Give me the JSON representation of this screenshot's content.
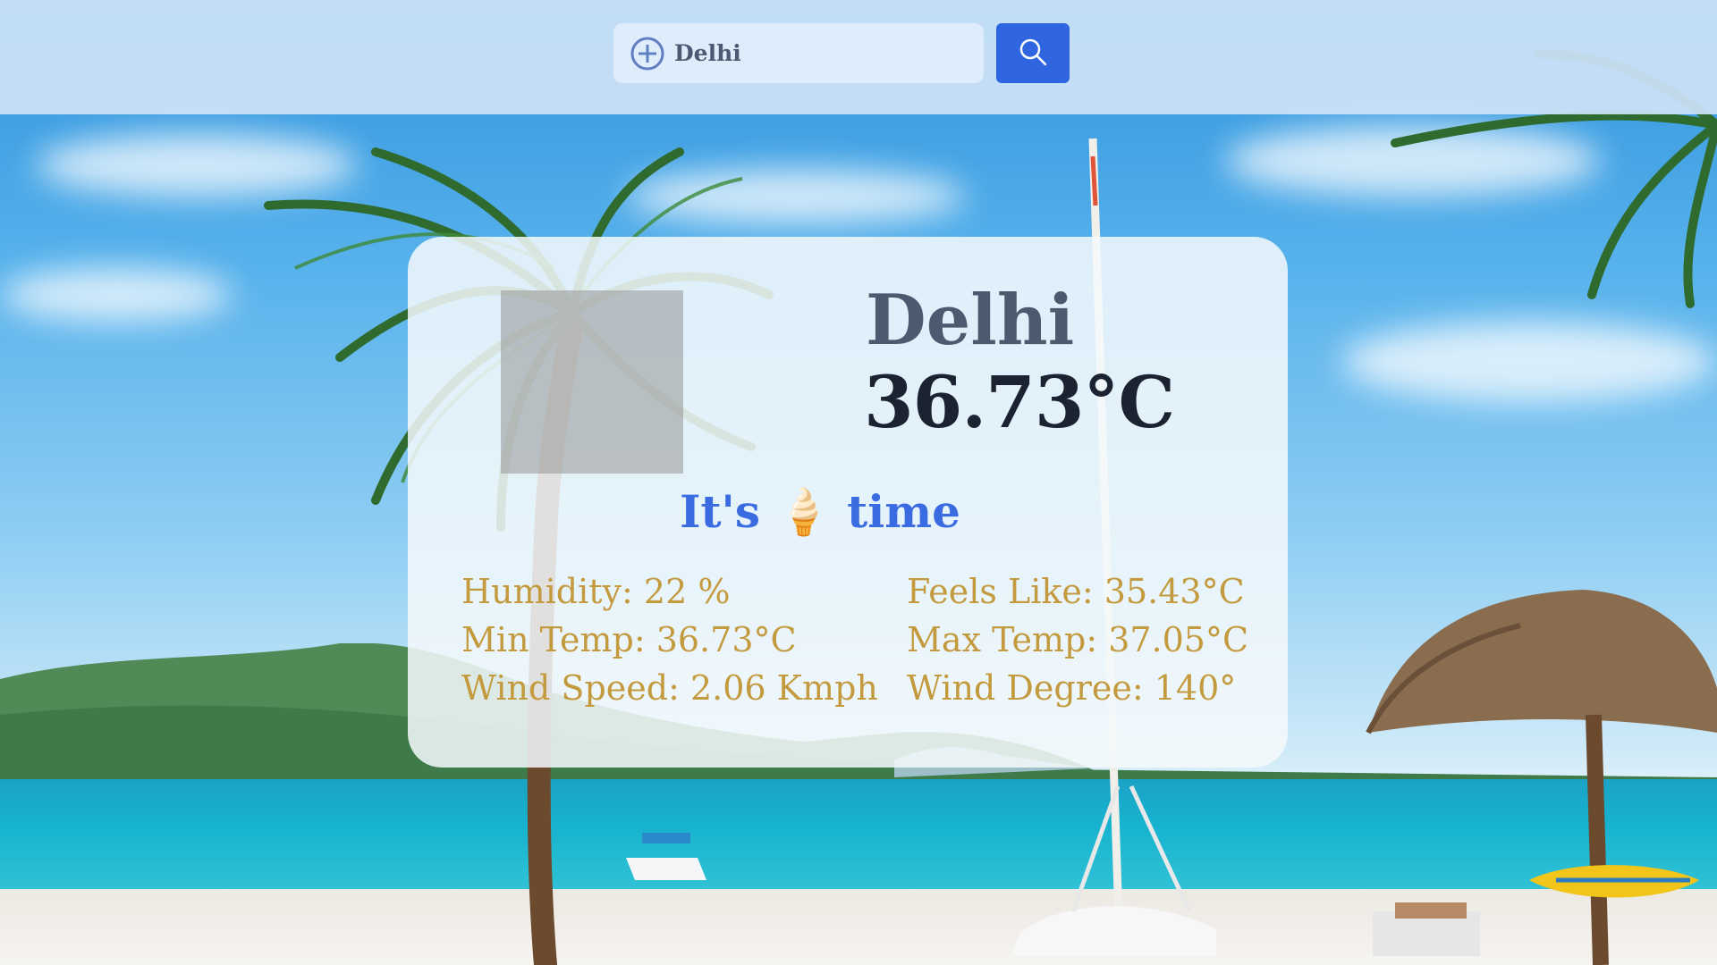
{
  "search": {
    "value": "Delhi",
    "plus_icon": "plus-circle-icon",
    "button_icon": "search-icon"
  },
  "weather": {
    "city": "Delhi",
    "temperature": "36.73°C",
    "message_prefix": "It's",
    "message_emoji": "🍦",
    "message_suffix": "time",
    "icon": "weather-icon"
  },
  "details": {
    "humidity": "Humidity: 22 %",
    "feels_like": "Feels Like: 35.43°C",
    "min_temp": "Min Temp: 36.73°C",
    "max_temp": "Max Temp: 37.05°C",
    "wind_speed": "Wind Speed: 2.06 Kmph",
    "wind_degree": "Wind Degree: 140°"
  },
  "colors": {
    "search_button": "#2f66e0",
    "message": "#3a6be0",
    "details": "#c49a3e",
    "city": "#4b5a6e",
    "temperature": "#1c2330"
  }
}
